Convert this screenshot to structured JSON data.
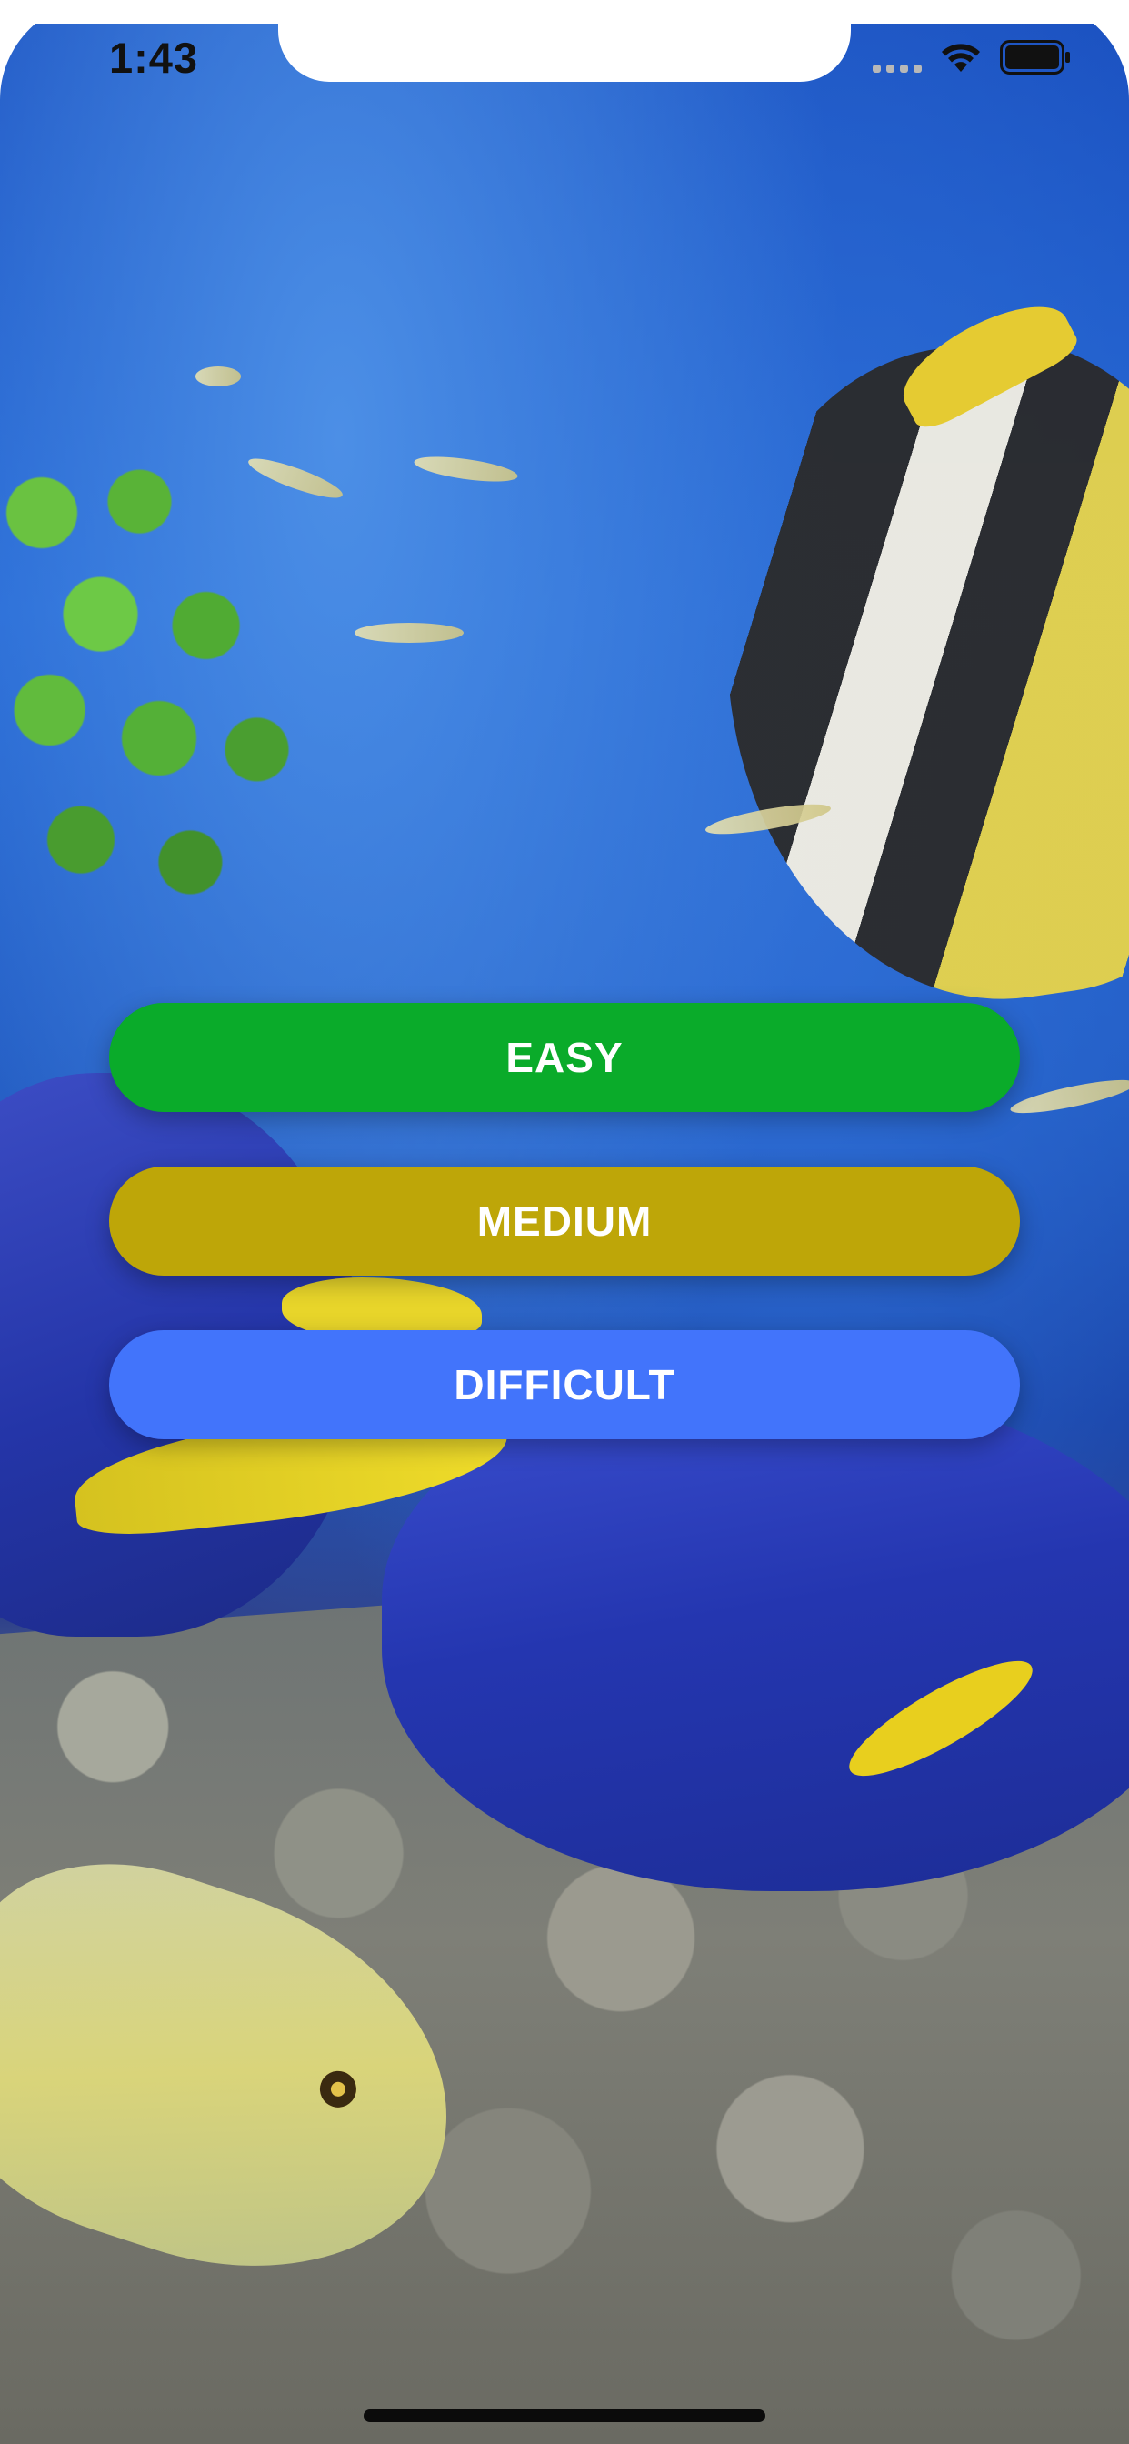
{
  "status_bar": {
    "time": "1:43",
    "signal_icon": "cellular-signal-icon",
    "wifi_icon": "wifi-icon",
    "battery_icon": "battery-icon"
  },
  "menu": {
    "buttons": [
      {
        "label": "EASY",
        "color": "#0aab2a"
      },
      {
        "label": "MEDIUM",
        "color": "#bea608"
      },
      {
        "label": "DIFFICULT",
        "color": "#4274fb"
      }
    ]
  },
  "background": {
    "description_icon": "underwater-photo"
  }
}
